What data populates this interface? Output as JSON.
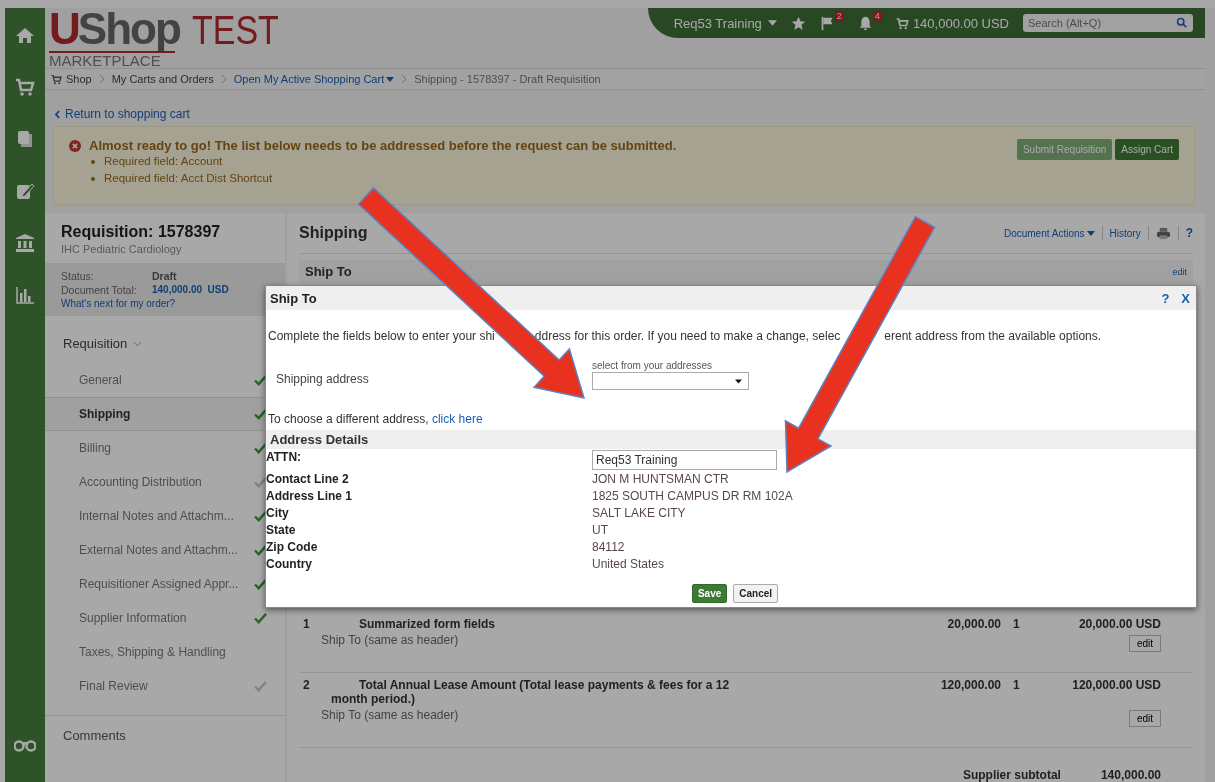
{
  "header": {
    "logo": {
      "mark": "U",
      "word": "Shop",
      "tag": "TEST",
      "sub": "MARKETPLACE"
    },
    "user": "Req53 Training",
    "flag_count": "2",
    "alert_count": "4",
    "cart_total": "140,000.00 USD",
    "search": {
      "placeholder": "Search (Alt+Q)"
    }
  },
  "breadcrumb": [
    {
      "label": "Shop",
      "kind": "home"
    },
    {
      "label": "My Carts and Orders",
      "kind": "plain"
    },
    {
      "label": "Open My Active Shopping Cart",
      "kind": "dropdown"
    },
    {
      "label": "Shipping - 1578397 - Draft Requisition",
      "kind": "current"
    }
  ],
  "return_link": "Return to shopping cart",
  "alert": {
    "message": "Almost ready to go! The list below needs to be addressed before the request can be submitted.",
    "items": [
      "Required field: Account",
      "Required field: Acct Dist Shortcut"
    ],
    "buttons": [
      {
        "label": "Submit Requisition",
        "disabled": true
      },
      {
        "label": "Assign Cart",
        "disabled": false
      }
    ]
  },
  "requisition": {
    "title": "Requisition: 1578397",
    "department": "IHC Pediatric Cardiology",
    "status_label": "Status:",
    "status": "Draft",
    "total_label": "Document Total:",
    "total": "140,000.00",
    "currency": "USD",
    "next_link": "What's next for my order?",
    "section": "Requisition",
    "nav": [
      {
        "label": "General",
        "selected": false,
        "kind": "complete"
      },
      {
        "label": "Shipping",
        "selected": true,
        "kind": "complete"
      },
      {
        "label": "Billing",
        "selected": false,
        "kind": "complete"
      },
      {
        "label": "Accounting Distribution",
        "selected": false,
        "kind": "incomplete"
      },
      {
        "label": "Internal Notes and Attachm...",
        "selected": false,
        "kind": "complete"
      },
      {
        "label": "External Notes and Attachm...",
        "selected": false,
        "kind": "complete"
      },
      {
        "label": "Requisitioner Assigned Appr...",
        "selected": false,
        "kind": "complete"
      },
      {
        "label": "Supplier Information",
        "selected": false,
        "kind": "complete"
      },
      {
        "label": "Taxes, Shipping & Handling",
        "selected": false,
        "kind": "open"
      },
      {
        "label": "Final Review",
        "selected": false,
        "kind": "incomplete"
      }
    ],
    "comments": "Comments"
  },
  "main": {
    "title": "Shipping",
    "document_actions": "Document Actions",
    "history": "History",
    "help": "?",
    "ship_to": {
      "title": "Ship To",
      "edit": "edit"
    },
    "lines": [
      {
        "number": "1",
        "description": "Summarized form fields",
        "price": "20,000.00",
        "quantity": "1",
        "total": "20,000.00 USD",
        "ship_to": "Ship To (same as header)",
        "edit": "edit"
      },
      {
        "number": "2",
        "description": "Total Annual Lease Amount (Total lease payments & fees for a 12 month period.)",
        "price": "120,000.00",
        "quantity": "1",
        "total": "120,000.00 USD",
        "ship_to": "Ship To (same as header)",
        "edit": "edit"
      }
    ],
    "subtotal": {
      "label": "Supplier subtotal",
      "value": "140,000.00"
    }
  },
  "dialog": {
    "title": "Ship To",
    "help": "?",
    "close": "X",
    "intro": [
      "Complete the fields below to enter your shi",
      "ddress for this order. If you need to make a change, selec",
      "erent address from the available options."
    ],
    "shipping_address": {
      "label": "Shipping address",
      "hint": "select from your addresses"
    },
    "different": {
      "text": "To choose a different address,",
      "link": "click here"
    },
    "section": "Address Details",
    "fields": [
      {
        "label": "ATTN:",
        "value": "Req53 Training",
        "kind": "input"
      },
      {
        "label": "Contact Line 2",
        "value": "JON M HUNTSMAN CTR",
        "kind": "text"
      },
      {
        "label": "Address Line 1",
        "value": "1825 SOUTH CAMPUS DR RM 102A",
        "kind": "text"
      },
      {
        "label": "City",
        "value": "SALT LAKE CITY",
        "kind": "text"
      },
      {
        "label": "State",
        "value": "UT",
        "kind": "text"
      },
      {
        "label": "Zip Code",
        "value": "84112",
        "kind": "text"
      },
      {
        "label": "Country",
        "value": "United States",
        "kind": "text"
      }
    ],
    "buttons": [
      {
        "label": "Save",
        "kind": "primary"
      },
      {
        "label": "Cancel",
        "kind": "secondary"
      }
    ]
  }
}
